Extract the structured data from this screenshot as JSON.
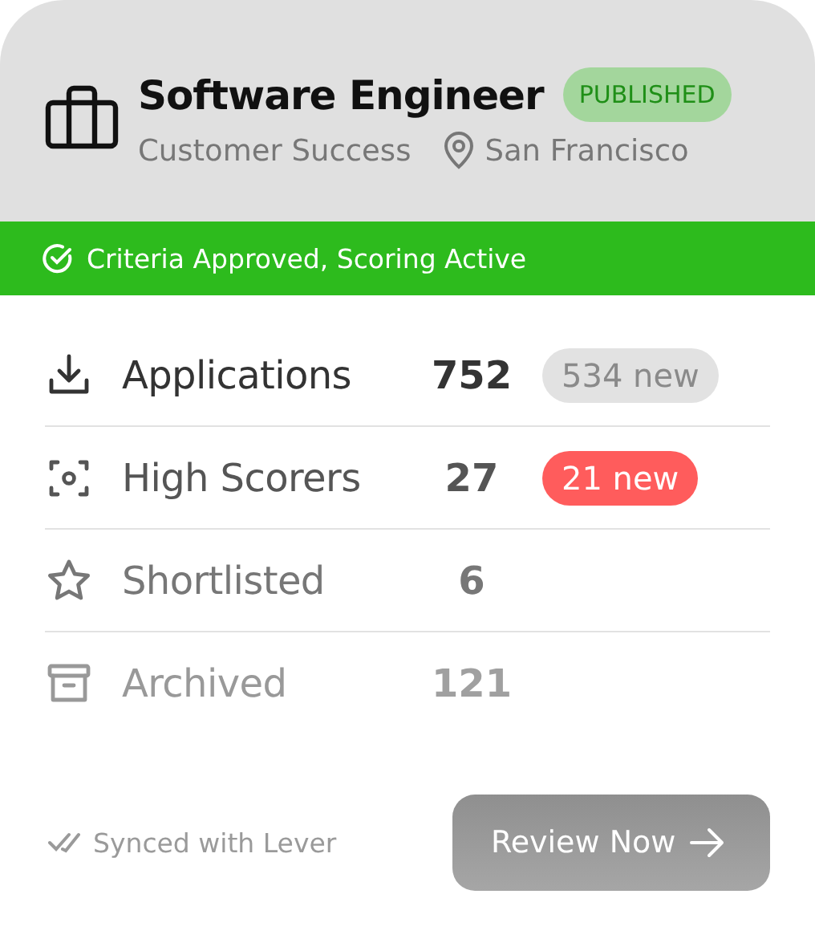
{
  "header": {
    "title": "Software Engineer",
    "status": "PUBLISHED",
    "department": "Customer Success",
    "location": "San Francisco"
  },
  "banner": {
    "text": "Criteria Approved, Scoring Active"
  },
  "stats": [
    {
      "kind": "download",
      "label": "Applications",
      "count": "752",
      "badge": "534 new",
      "color": "#e2e2e2"
    },
    {
      "kind": "scan",
      "label": "High Scorers",
      "count": "27",
      "badge": "21 new",
      "color": "#ff5c5c"
    },
    {
      "kind": "star",
      "label": "Shortlisted",
      "count": "6"
    },
    {
      "kind": "archive",
      "label": "Archived",
      "count": "121"
    }
  ],
  "footer": {
    "sync": "Synced with Lever",
    "button": "Review Now"
  }
}
